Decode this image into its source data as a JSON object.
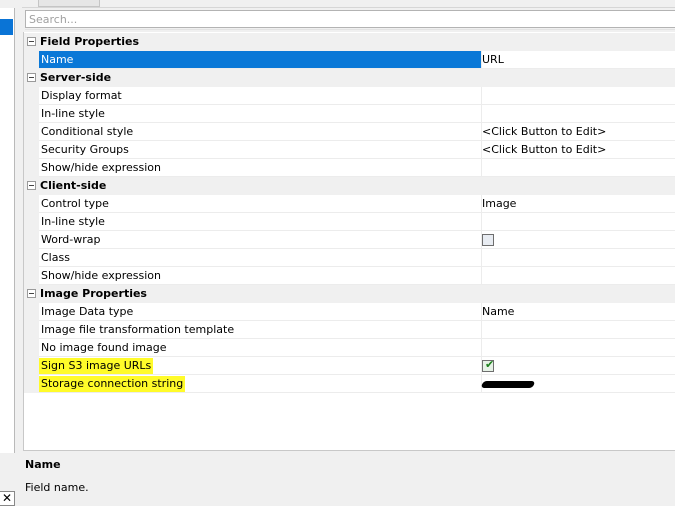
{
  "search": {
    "placeholder": "Search..."
  },
  "categories": [
    {
      "label": "Field Properties",
      "properties": [
        {
          "name": "Name",
          "value": "URL",
          "selected": true
        }
      ]
    },
    {
      "label": "Server-side",
      "properties": [
        {
          "name": "Display format",
          "value": ""
        },
        {
          "name": "In-line style",
          "value": ""
        },
        {
          "name": "Conditional style",
          "value": "<Click Button to Edit>"
        },
        {
          "name": "Security Groups",
          "value": "<Click Button to Edit>"
        },
        {
          "name": "Show/hide expression",
          "value": ""
        }
      ]
    },
    {
      "label": "Client-side",
      "properties": [
        {
          "name": "Control type",
          "value": "Image"
        },
        {
          "name": "In-line style",
          "value": ""
        },
        {
          "name": "Word-wrap",
          "checkbox": false
        },
        {
          "name": "Class",
          "value": ""
        },
        {
          "name": "Show/hide expression",
          "value": ""
        }
      ]
    },
    {
      "label": "Image Properties",
      "properties": [
        {
          "name": "Image Data type",
          "value": "Name"
        },
        {
          "name": "Image file transformation template",
          "value": ""
        },
        {
          "name": "No image found image",
          "value": ""
        },
        {
          "name": "Sign S3 image URLs",
          "checkbox": true,
          "highlighted": true
        },
        {
          "name": "Storage connection string",
          "value": "",
          "redacted": true,
          "highlighted": true
        }
      ]
    }
  ],
  "help": {
    "title": "Name",
    "description": "Field name."
  },
  "left_panel": {
    "close_glyph": "✕"
  },
  "colors": {
    "selection": "#0a78d7",
    "highlight": "#fffb2a",
    "category_bg": "#f0f0f0"
  }
}
